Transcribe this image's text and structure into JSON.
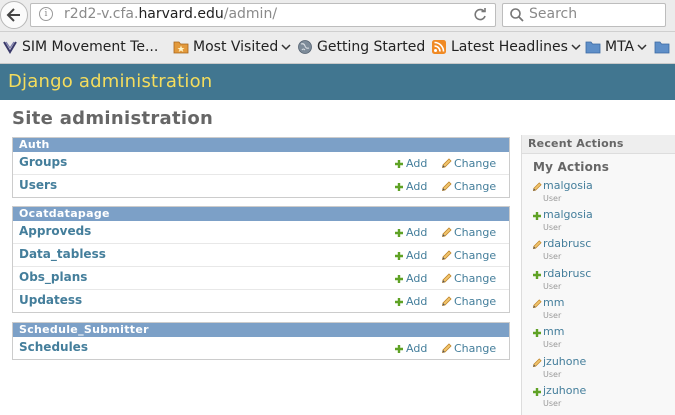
{
  "browser": {
    "url_prefix": "r2d2-v.cfa.",
    "url_domain": "harvard.edu",
    "url_path": "/admin/",
    "search_placeholder": "Search"
  },
  "bookmarks": [
    {
      "label": "SIM Movement Te...",
      "icon": "page-favicon"
    },
    {
      "label": "Most Visited",
      "icon": "folder-star-icon",
      "dropdown": true
    },
    {
      "label": "Getting Started",
      "icon": "globe-icon"
    },
    {
      "label": "Latest Headlines",
      "icon": "rss-icon",
      "dropdown": true
    },
    {
      "label": "MTA",
      "icon": "folder-icon",
      "dropdown": true
    }
  ],
  "header": {
    "brand": "Django administration"
  },
  "page_title": "Site administration",
  "actions": {
    "add": "Add",
    "change": "Change"
  },
  "modules": [
    {
      "caption": "Auth",
      "models": [
        "Groups",
        "Users"
      ]
    },
    {
      "caption": "Ocatdatapage",
      "models": [
        "Approveds",
        "Data_tabless",
        "Obs_plans",
        "Updatess"
      ]
    },
    {
      "caption": "Schedule_Submitter",
      "models": [
        "Schedules"
      ]
    }
  ],
  "recent": {
    "caption": "Recent Actions",
    "my_actions": "My Actions",
    "items": [
      {
        "name": "malgosia",
        "type": "User",
        "action": "change"
      },
      {
        "name": "malgosia",
        "type": "User",
        "action": "add"
      },
      {
        "name": "rdabrusc",
        "type": "User",
        "action": "change"
      },
      {
        "name": "rdabrusc",
        "type": "User",
        "action": "add"
      },
      {
        "name": "mm",
        "type": "User",
        "action": "change"
      },
      {
        "name": "mm",
        "type": "User",
        "action": "add"
      },
      {
        "name": "jzuhone",
        "type": "User",
        "action": "change"
      },
      {
        "name": "jzuhone",
        "type": "User",
        "action": "add"
      }
    ]
  },
  "colors": {
    "header_bg": "#417690",
    "brand_text": "#f5dd5d",
    "module_caption": "#7ca0c7",
    "link": "#447e9b",
    "add_green": "#5fa225",
    "change_orange": "#e0902a"
  }
}
